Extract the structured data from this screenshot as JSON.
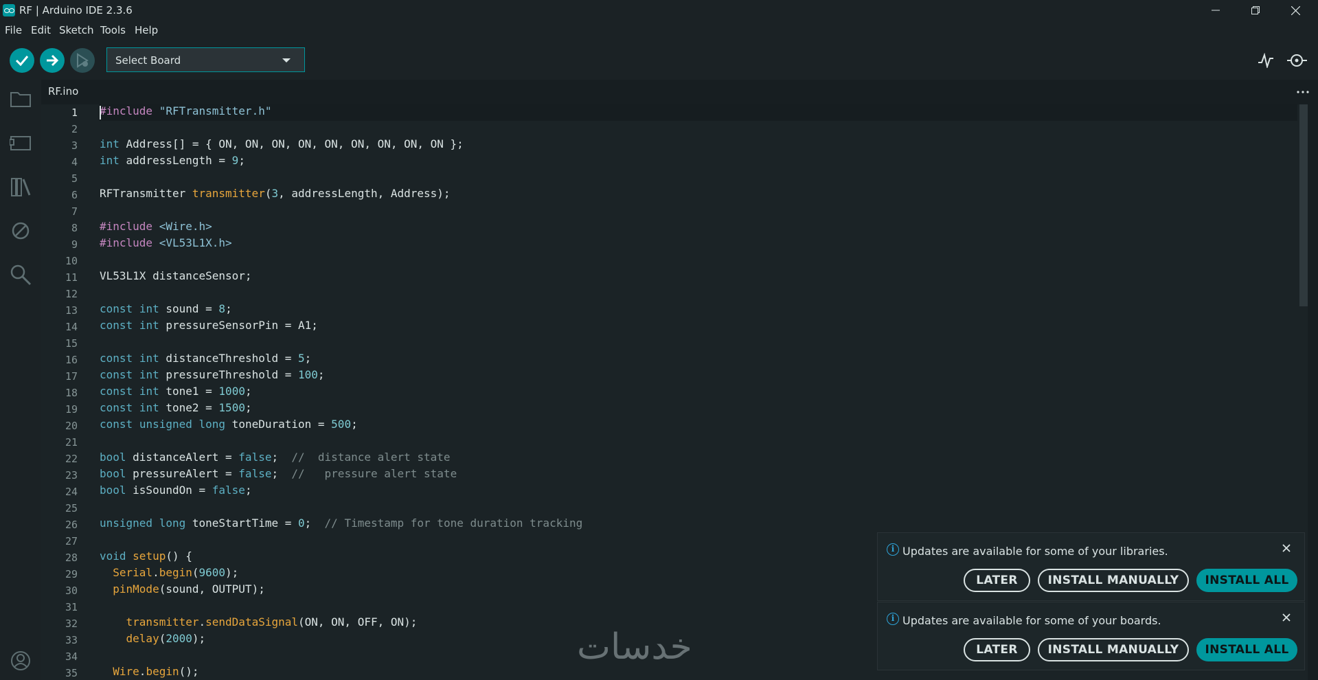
{
  "window": {
    "title": "RF | Arduino IDE 2.3.6"
  },
  "menu": [
    "File",
    "Edit",
    "Sketch",
    "Tools",
    "Help"
  ],
  "toolbar": {
    "board_select": "Select Board"
  },
  "tabs": [
    {
      "label": "RF.ino"
    }
  ],
  "editor": {
    "active_line": 1,
    "line_numbers": [
      "1",
      "2",
      "3",
      "4",
      "5",
      "6",
      "7",
      "8",
      "9",
      "10",
      "11",
      "12",
      "13",
      "14",
      "15",
      "16",
      "17",
      "18",
      "19",
      "20",
      "21",
      "22",
      "23",
      "24",
      "25",
      "26",
      "27",
      "28",
      "29",
      "30",
      "31",
      "32",
      "33",
      "34",
      "35"
    ],
    "lines": [
      "#include \"RFTransmitter.h\"",
      "",
      "int Address[] = { ON, ON, ON, ON, ON, ON, ON, ON, ON };",
      "int addressLength = 9;",
      "",
      "RFTransmitter transmitter(3, addressLength, Address);",
      "",
      "#include <Wire.h>",
      "#include <VL53L1X.h>",
      "",
      "VL53L1X distanceSensor;",
      "",
      "const int sound = 8;",
      "const int pressureSensorPin = A1;",
      "",
      "const int distanceThreshold = 5;",
      "const int pressureThreshold = 100;",
      "const int tone1 = 1000;",
      "const int tone2 = 1500;",
      "const unsigned long toneDuration = 500;",
      "",
      "bool distanceAlert = false;  //  distance alert state",
      "bool pressureAlert = false;  //   pressure alert state",
      "bool isSoundOn = false;",
      "",
      "unsigned long toneStartTime = 0;  // Timestamp for tone duration tracking",
      "",
      "void setup() {",
      "  Serial.begin(9600);",
      "  pinMode(sound, OUTPUT);",
      "",
      "    transmitter.sendDataSignal(ON, ON, OFF, ON);",
      "    delay(2000);",
      "",
      "  Wire.begin();"
    ]
  },
  "notifications": [
    {
      "message": "Updates are available for some of your libraries.",
      "later": "LATER",
      "manual": "INSTALL MANUALLY",
      "all": "INSTALL ALL"
    },
    {
      "message": "Updates are available for some of your boards.",
      "later": "LATER",
      "manual": "INSTALL MANUALLY",
      "all": "INSTALL ALL"
    }
  ],
  "watermark": "خدسات",
  "colors": {
    "accent": "#00979d",
    "background": "#171e21",
    "info": "#2ea3d8"
  },
  "icons": [
    "verify-icon",
    "upload-icon",
    "debug-icon",
    "folder-icon",
    "boards-icon",
    "library-icon",
    "block-icon",
    "search-icon",
    "user-icon",
    "serial-plotter-icon",
    "serial-monitor-icon",
    "more-icon",
    "close-icon",
    "info-icon"
  ]
}
